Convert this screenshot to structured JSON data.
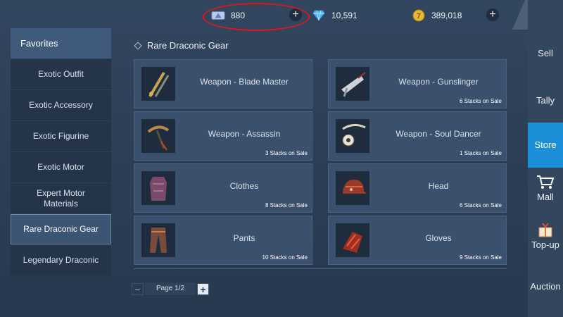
{
  "currencies": [
    {
      "icon": "crystal-ticket-icon",
      "value": "880",
      "has_add": true
    },
    {
      "icon": "blue-diamond-icon",
      "value": "10,591",
      "has_add": false
    },
    {
      "icon": "gold-coin-icon",
      "value": "389,018",
      "has_add": true
    }
  ],
  "left_nav": {
    "header": "Favorites",
    "items": [
      "Exotic Outfit",
      "Exotic Accessory",
      "Exotic Figurine",
      "Exotic Motor",
      "Expert Motor Materials",
      "Rare Draconic Gear",
      "Legendary Draconic"
    ],
    "active": "Rare Draconic Gear"
  },
  "section": {
    "title": "Rare Draconic Gear"
  },
  "items": [
    {
      "name": "Weapon - Blade Master",
      "stacks": "",
      "icon": "twin-blades-icon"
    },
    {
      "name": "Weapon - Gunslinger",
      "stacks": "6 Stacks on Sale",
      "icon": "gunblade-icon"
    },
    {
      "name": "Weapon - Assassin",
      "stacks": "3 Stacks on Sale",
      "icon": "scythe-blade-icon"
    },
    {
      "name": "Weapon - Soul Dancer",
      "stacks": "1 Stacks on Sale",
      "icon": "orb-wand-icon"
    },
    {
      "name": "Clothes",
      "stacks": "8 Stacks on Sale",
      "icon": "armor-icon"
    },
    {
      "name": "Head",
      "stacks": "6 Stacks on Sale",
      "icon": "helmet-icon"
    },
    {
      "name": "Pants",
      "stacks": "10 Stacks on Sale",
      "icon": "pants-icon"
    },
    {
      "name": "Gloves",
      "stacks": "9 Stacks on Sale",
      "icon": "gloves-icon"
    }
  ],
  "pager": {
    "label": "Page 1/2"
  },
  "right_sidebar": [
    {
      "label": "Sell",
      "icon": ""
    },
    {
      "label": "Tally",
      "icon": ""
    },
    {
      "label": "Store",
      "icon": "",
      "active": true
    },
    {
      "label": "Mall",
      "icon": "cart-icon"
    },
    {
      "label": "Top-up",
      "icon": "gift-box-icon"
    },
    {
      "label": "Auction",
      "icon": ""
    }
  ],
  "colors": {
    "accent": "#1d8fd8",
    "highlight_circle": "#d61a1a"
  }
}
